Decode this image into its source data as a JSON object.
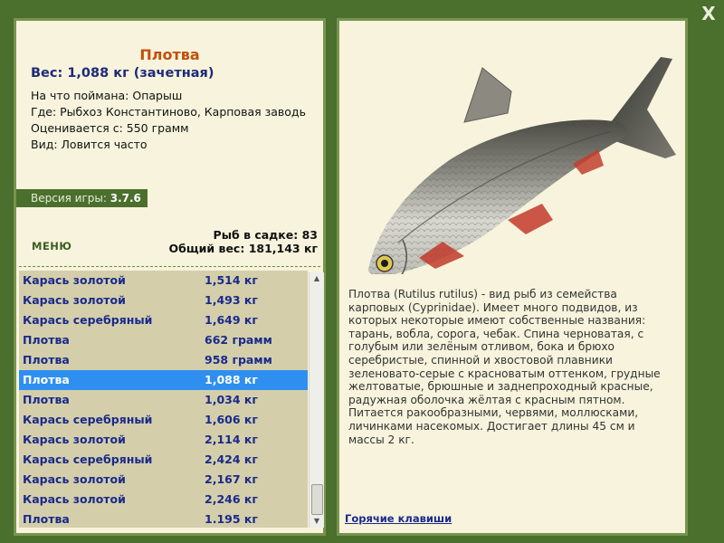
{
  "window": {
    "close_label": "X"
  },
  "fish": {
    "name": "Плотва",
    "weight_line": "Вес: 1,088 кг (зачетная)",
    "bait_line": "На что поймана: Опарыш",
    "place_line": "Где: Рыбхоз Константиново, Карповая заводь",
    "value_line": "Оценивается с: 550 грамм",
    "kind_line": "Вид: Ловится часто",
    "description": "Плотва (Rutilus rutilus) - вид рыб из семейства карповых (Cyprinidae). Имеет много подвидов, из которых некоторые имеют собственные названия: тарань, вобла, сорога, чебак. Спина черноватая, с голубым или зелёным отливом, бока и брюхо серебристые, спинной и хвостовой плавники зеленовато-серые с красноватым оттенком, грудные желтоватые, брюшные и заднепроходный красные, радужная оболочка жёлтая с красным пятном. Питается ракообразными, червями, моллюсками, личинками насекомых. Достигает длины 45 см и массы 2 кг."
  },
  "version": {
    "label": "Версия игры: ",
    "value": "3.7.6"
  },
  "menu_label": "МЕНЮ",
  "stats": {
    "count_line": "Рыб в садке: 83",
    "total_line": "Общий вес: 181,143 кг"
  },
  "catch_list": [
    {
      "name": "Карась золотой",
      "weight": "1,514 кг"
    },
    {
      "name": "Карась золотой",
      "weight": "1,493 кг"
    },
    {
      "name": "Карась серебряный",
      "weight": "1,649 кг"
    },
    {
      "name": "Плотва",
      "weight": "662 грамм"
    },
    {
      "name": "Плотва",
      "weight": "958 грамм"
    },
    {
      "name": "Плотва",
      "weight": "1,088 кг"
    },
    {
      "name": "Плотва",
      "weight": "1,034 кг"
    },
    {
      "name": "Карась серебряный",
      "weight": "1,606 кг"
    },
    {
      "name": "Карась золотой",
      "weight": "2,114 кг"
    },
    {
      "name": "Карась серебряный",
      "weight": "2,424 кг"
    },
    {
      "name": "Карась золотой",
      "weight": "2,167 кг"
    },
    {
      "name": "Карась золотой",
      "weight": "2,246 кг"
    },
    {
      "name": "Плотва",
      "weight": "1.195 кг"
    }
  ],
  "selected_index": 5,
  "hotkeys_label": "Горячие клавиши",
  "colors": {
    "background": "#4b6f2c",
    "panel": "#f7f3dc",
    "list_bg": "#d4cfaa",
    "selection": "#2e8ff0",
    "title": "#c0500a",
    "link": "#1a2a8c"
  }
}
